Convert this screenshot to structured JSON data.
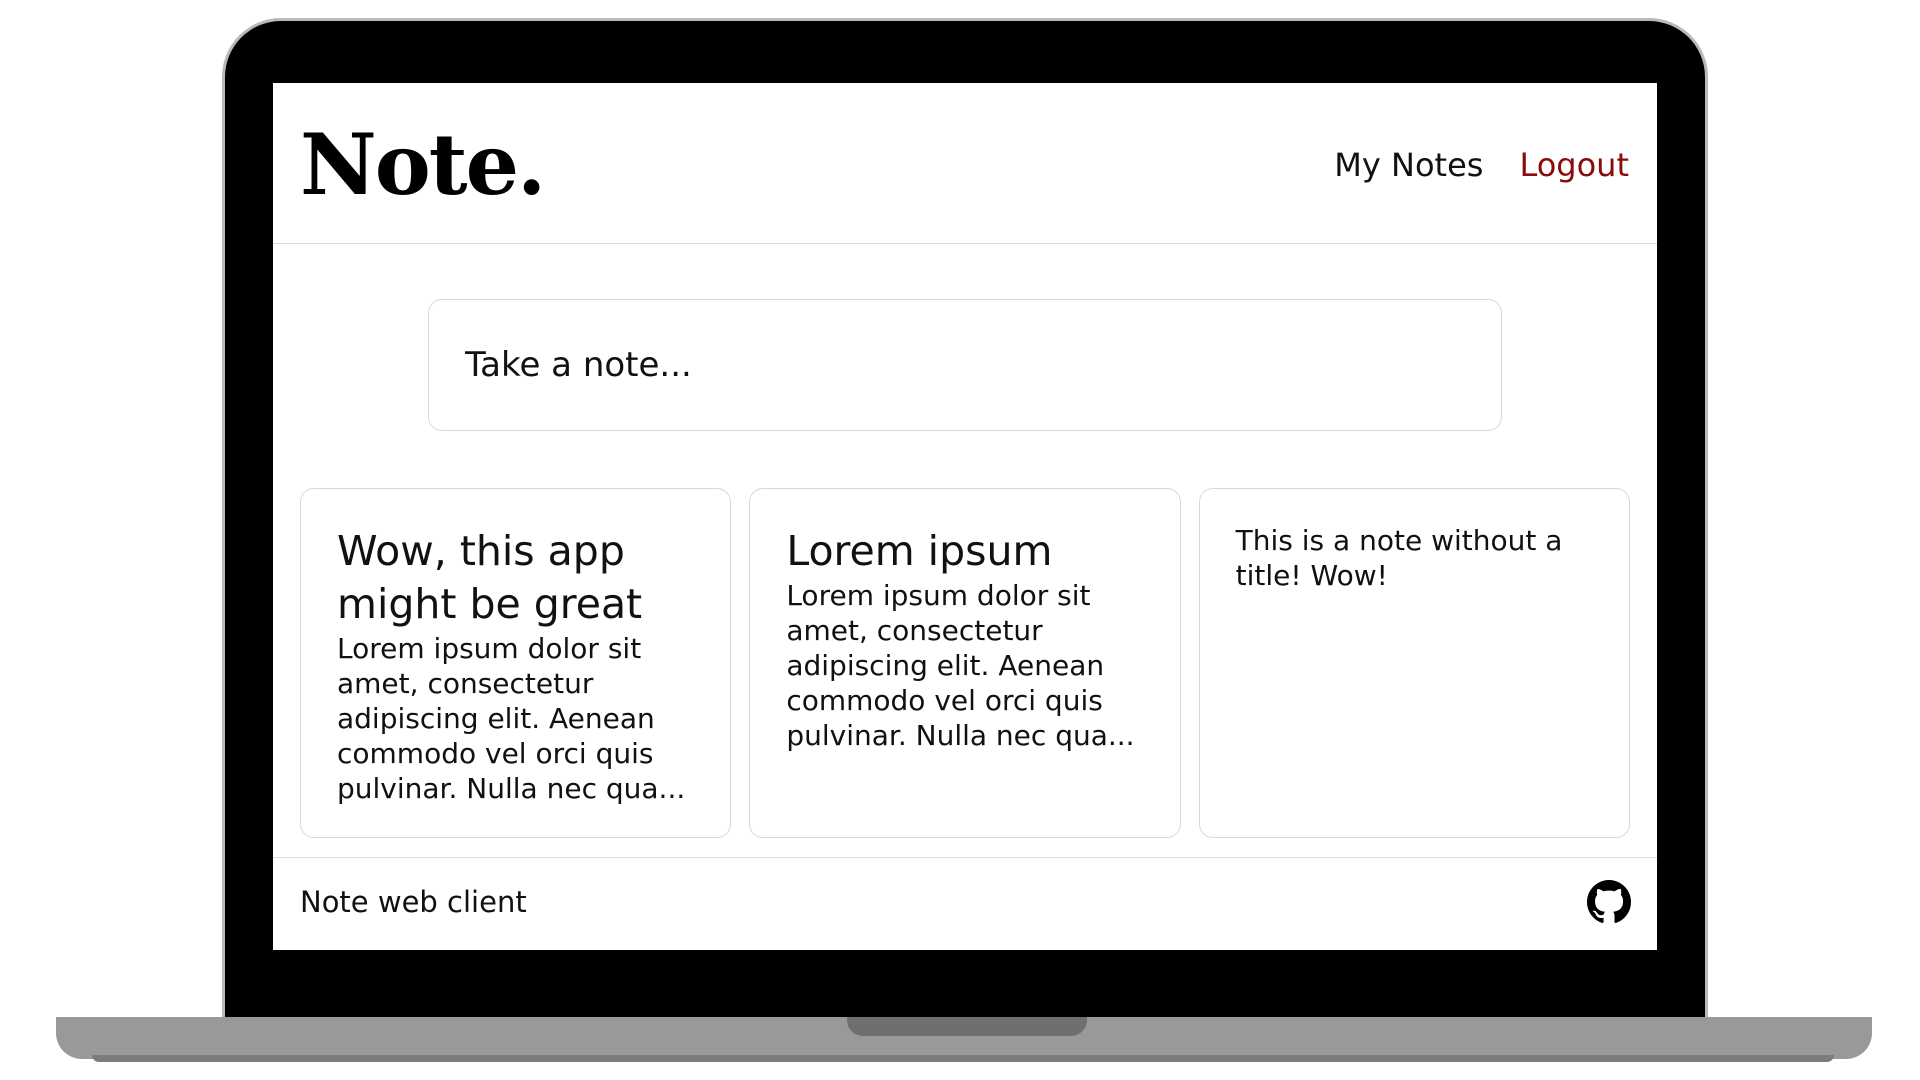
{
  "header": {
    "logo_text": "Note.",
    "nav": {
      "my_notes": "My Notes",
      "logout": "Logout"
    }
  },
  "composer": {
    "placeholder": "Take a note..."
  },
  "notes": [
    {
      "title": "Wow, this app might be great",
      "body": "Lorem ipsum dolor sit amet, consectetur adipiscing elit. Aenean commodo vel orci quis pulvinar. Nulla nec qua..."
    },
    {
      "title": "Lorem ipsum",
      "body": "Lorem ipsum dolor sit amet, consectetur adipiscing elit. Aenean commodo vel orci quis pulvinar. Nulla nec qua..."
    },
    {
      "title": "",
      "body": "This is a note without a title! Wow!"
    }
  ],
  "footer": {
    "text": "Note web client",
    "icon": "github-icon"
  },
  "colors": {
    "logout": "#8b0a0a",
    "text": "#111111",
    "border": "#d8d8d8",
    "bezel": "#000000",
    "base": "#999999"
  }
}
